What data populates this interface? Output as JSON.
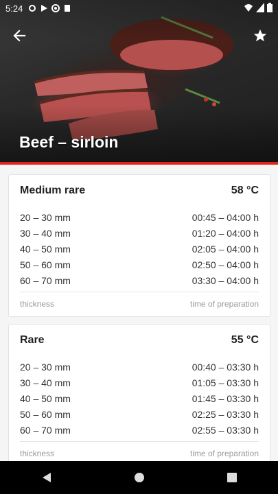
{
  "status_bar": {
    "time": "5:24"
  },
  "header": {
    "title": "Beef – sirloin"
  },
  "colors": {
    "accent": "#e2231a"
  },
  "cards": [
    {
      "title": "Medium rare",
      "temperature": "58 °C",
      "rows": [
        {
          "thickness": "20 – 30 mm",
          "time": "00:45 – 04:00 h"
        },
        {
          "thickness": "30 – 40 mm",
          "time": "01:20 – 04:00 h"
        },
        {
          "thickness": "40 – 50 mm",
          "time": "02:05 – 04:00 h"
        },
        {
          "thickness": "50 – 60 mm",
          "time": "02:50 – 04:00 h"
        },
        {
          "thickness": "60 – 70 mm",
          "time": "03:30 – 04:00 h"
        }
      ],
      "footer_left": "thickness",
      "footer_right": "time of preparation"
    },
    {
      "title": "Rare",
      "temperature": "55 °C",
      "rows": [
        {
          "thickness": "20 – 30 mm",
          "time": "00:40 – 03:30 h"
        },
        {
          "thickness": "30 – 40 mm",
          "time": "01:05 – 03:30 h"
        },
        {
          "thickness": "40 – 50 mm",
          "time": "01:45 – 03:30 h"
        },
        {
          "thickness": "50 – 60 mm",
          "time": "02:25 – 03:30 h"
        },
        {
          "thickness": "60 – 70 mm",
          "time": "02:55 – 03:30 h"
        }
      ],
      "footer_left": "thickness",
      "footer_right": "time of preparation"
    }
  ],
  "icons": {
    "back": "arrow-left-icon",
    "favorite": "star-icon",
    "nav_back": "triangle-back-icon",
    "nav_home": "circle-home-icon",
    "nav_recents": "square-recents-icon"
  }
}
